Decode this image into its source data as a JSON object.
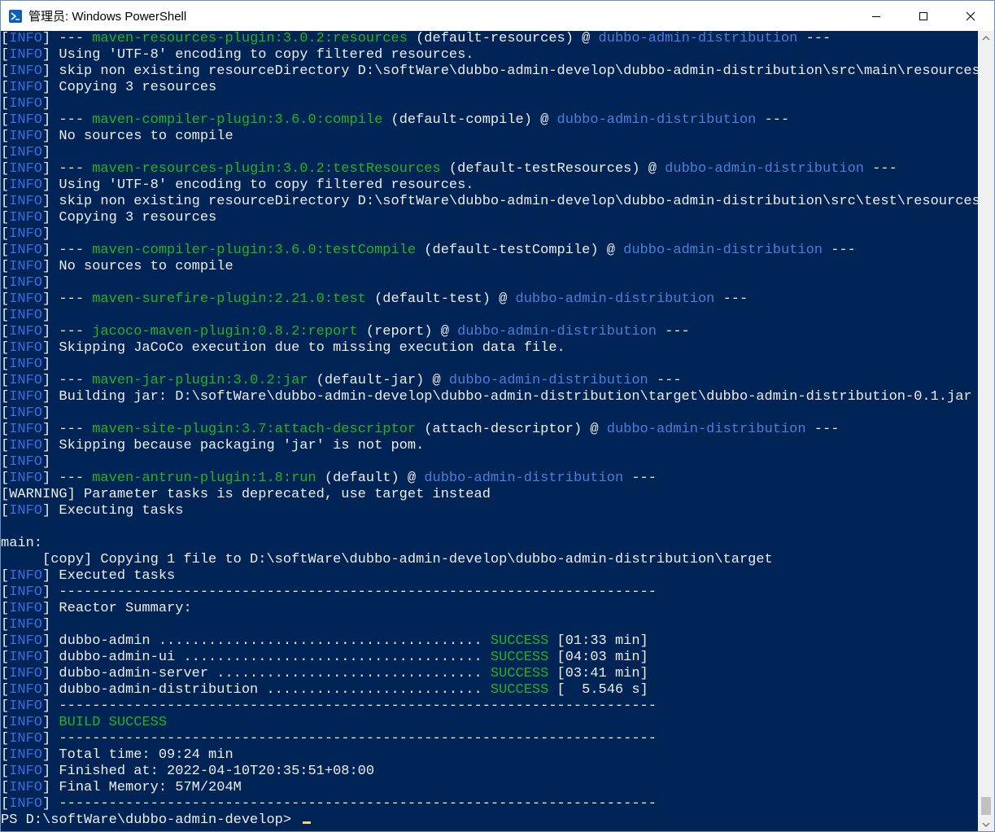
{
  "window": {
    "title": "管理员: Windows PowerShell",
    "controls": [
      "minimize",
      "maximize",
      "close"
    ]
  },
  "colors": {
    "console_bg": "#012456",
    "text": "#eeedf0",
    "info_tag": "#3a6fe0",
    "plugin": "#24b324",
    "module": "#4d7fd8",
    "success": "#24b324"
  },
  "lines": [
    [
      {
        "t": "[",
        "c": "n"
      },
      {
        "t": "INFO",
        "c": "info"
      },
      {
        "t": "] --- ",
        "c": "n"
      },
      {
        "t": "maven-resources-plugin:3.0.2:resources",
        "c": "plugin"
      },
      {
        "t": " (default-resources) @ ",
        "c": "n"
      },
      {
        "t": "dubbo-admin-distribution",
        "c": "module"
      },
      {
        "t": " ---",
        "c": "n"
      }
    ],
    [
      {
        "t": "[",
        "c": "n"
      },
      {
        "t": "INFO",
        "c": "info"
      },
      {
        "t": "] Using 'UTF-8' encoding to copy filtered resources.",
        "c": "n"
      }
    ],
    [
      {
        "t": "[",
        "c": "n"
      },
      {
        "t": "INFO",
        "c": "info"
      },
      {
        "t": "] skip non existing resourceDirectory D:\\softWare\\dubbo-admin-develop\\dubbo-admin-distribution\\src\\main\\resources",
        "c": "n"
      }
    ],
    [
      {
        "t": "[",
        "c": "n"
      },
      {
        "t": "INFO",
        "c": "info"
      },
      {
        "t": "] Copying 3 resources",
        "c": "n"
      }
    ],
    [
      {
        "t": "[",
        "c": "n"
      },
      {
        "t": "INFO",
        "c": "info"
      },
      {
        "t": "]",
        "c": "n"
      }
    ],
    [
      {
        "t": "[",
        "c": "n"
      },
      {
        "t": "INFO",
        "c": "info"
      },
      {
        "t": "] --- ",
        "c": "n"
      },
      {
        "t": "maven-compiler-plugin:3.6.0:compile",
        "c": "plugin"
      },
      {
        "t": " (default-compile) @ ",
        "c": "n"
      },
      {
        "t": "dubbo-admin-distribution",
        "c": "module"
      },
      {
        "t": " ---",
        "c": "n"
      }
    ],
    [
      {
        "t": "[",
        "c": "n"
      },
      {
        "t": "INFO",
        "c": "info"
      },
      {
        "t": "] No sources to compile",
        "c": "n"
      }
    ],
    [
      {
        "t": "[",
        "c": "n"
      },
      {
        "t": "INFO",
        "c": "info"
      },
      {
        "t": "]",
        "c": "n"
      }
    ],
    [
      {
        "t": "[",
        "c": "n"
      },
      {
        "t": "INFO",
        "c": "info"
      },
      {
        "t": "] --- ",
        "c": "n"
      },
      {
        "t": "maven-resources-plugin:3.0.2:testResources",
        "c": "plugin"
      },
      {
        "t": " (default-testResources) @ ",
        "c": "n"
      },
      {
        "t": "dubbo-admin-distribution",
        "c": "module"
      },
      {
        "t": " ---",
        "c": "n"
      }
    ],
    [
      {
        "t": "[",
        "c": "n"
      },
      {
        "t": "INFO",
        "c": "info"
      },
      {
        "t": "] Using 'UTF-8' encoding to copy filtered resources.",
        "c": "n"
      }
    ],
    [
      {
        "t": "[",
        "c": "n"
      },
      {
        "t": "INFO",
        "c": "info"
      },
      {
        "t": "] skip non existing resourceDirectory D:\\softWare\\dubbo-admin-develop\\dubbo-admin-distribution\\src\\test\\resources",
        "c": "n"
      }
    ],
    [
      {
        "t": "[",
        "c": "n"
      },
      {
        "t": "INFO",
        "c": "info"
      },
      {
        "t": "] Copying 3 resources",
        "c": "n"
      }
    ],
    [
      {
        "t": "[",
        "c": "n"
      },
      {
        "t": "INFO",
        "c": "info"
      },
      {
        "t": "]",
        "c": "n"
      }
    ],
    [
      {
        "t": "[",
        "c": "n"
      },
      {
        "t": "INFO",
        "c": "info"
      },
      {
        "t": "] --- ",
        "c": "n"
      },
      {
        "t": "maven-compiler-plugin:3.6.0:testCompile",
        "c": "plugin"
      },
      {
        "t": " (default-testCompile) @ ",
        "c": "n"
      },
      {
        "t": "dubbo-admin-distribution",
        "c": "module"
      },
      {
        "t": " ---",
        "c": "n"
      }
    ],
    [
      {
        "t": "[",
        "c": "n"
      },
      {
        "t": "INFO",
        "c": "info"
      },
      {
        "t": "] No sources to compile",
        "c": "n"
      }
    ],
    [
      {
        "t": "[",
        "c": "n"
      },
      {
        "t": "INFO",
        "c": "info"
      },
      {
        "t": "]",
        "c": "n"
      }
    ],
    [
      {
        "t": "[",
        "c": "n"
      },
      {
        "t": "INFO",
        "c": "info"
      },
      {
        "t": "] --- ",
        "c": "n"
      },
      {
        "t": "maven-surefire-plugin:2.21.0:test",
        "c": "plugin"
      },
      {
        "t": " (default-test) @ ",
        "c": "n"
      },
      {
        "t": "dubbo-admin-distribution",
        "c": "module"
      },
      {
        "t": " ---",
        "c": "n"
      }
    ],
    [
      {
        "t": "[",
        "c": "n"
      },
      {
        "t": "INFO",
        "c": "info"
      },
      {
        "t": "]",
        "c": "n"
      }
    ],
    [
      {
        "t": "[",
        "c": "n"
      },
      {
        "t": "INFO",
        "c": "info"
      },
      {
        "t": "] --- ",
        "c": "n"
      },
      {
        "t": "jacoco-maven-plugin:0.8.2:report",
        "c": "plugin"
      },
      {
        "t": " (report) @ ",
        "c": "n"
      },
      {
        "t": "dubbo-admin-distribution",
        "c": "module"
      },
      {
        "t": " ---",
        "c": "n"
      }
    ],
    [
      {
        "t": "[",
        "c": "n"
      },
      {
        "t": "INFO",
        "c": "info"
      },
      {
        "t": "] Skipping JaCoCo execution due to missing execution data file.",
        "c": "n"
      }
    ],
    [
      {
        "t": "[",
        "c": "n"
      },
      {
        "t": "INFO",
        "c": "info"
      },
      {
        "t": "]",
        "c": "n"
      }
    ],
    [
      {
        "t": "[",
        "c": "n"
      },
      {
        "t": "INFO",
        "c": "info"
      },
      {
        "t": "] --- ",
        "c": "n"
      },
      {
        "t": "maven-jar-plugin:3.0.2:jar",
        "c": "plugin"
      },
      {
        "t": " (default-jar) @ ",
        "c": "n"
      },
      {
        "t": "dubbo-admin-distribution",
        "c": "module"
      },
      {
        "t": " ---",
        "c": "n"
      }
    ],
    [
      {
        "t": "[",
        "c": "n"
      },
      {
        "t": "INFO",
        "c": "info"
      },
      {
        "t": "] Building jar: D:\\softWare\\dubbo-admin-develop\\dubbo-admin-distribution\\target\\dubbo-admin-distribution-0.1.jar",
        "c": "n"
      }
    ],
    [
      {
        "t": "[",
        "c": "n"
      },
      {
        "t": "INFO",
        "c": "info"
      },
      {
        "t": "]",
        "c": "n"
      }
    ],
    [
      {
        "t": "[",
        "c": "n"
      },
      {
        "t": "INFO",
        "c": "info"
      },
      {
        "t": "] --- ",
        "c": "n"
      },
      {
        "t": "maven-site-plugin:3.7:attach-descriptor",
        "c": "plugin"
      },
      {
        "t": " (attach-descriptor) @ ",
        "c": "n"
      },
      {
        "t": "dubbo-admin-distribution",
        "c": "module"
      },
      {
        "t": " ---",
        "c": "n"
      }
    ],
    [
      {
        "t": "[",
        "c": "n"
      },
      {
        "t": "INFO",
        "c": "info"
      },
      {
        "t": "] Skipping because packaging 'jar' is not pom.",
        "c": "n"
      }
    ],
    [
      {
        "t": "[",
        "c": "n"
      },
      {
        "t": "INFO",
        "c": "info"
      },
      {
        "t": "]",
        "c": "n"
      }
    ],
    [
      {
        "t": "[",
        "c": "n"
      },
      {
        "t": "INFO",
        "c": "info"
      },
      {
        "t": "] --- ",
        "c": "n"
      },
      {
        "t": "maven-antrun-plugin:1.8:run",
        "c": "plugin"
      },
      {
        "t": " (default) @ ",
        "c": "n"
      },
      {
        "t": "dubbo-admin-distribution",
        "c": "module"
      },
      {
        "t": " ---",
        "c": "n"
      }
    ],
    [
      {
        "t": "[WARNING] Parameter tasks is deprecated, use target instead",
        "c": "n"
      }
    ],
    [
      {
        "t": "[",
        "c": "n"
      },
      {
        "t": "INFO",
        "c": "info"
      },
      {
        "t": "] Executing tasks",
        "c": "n"
      }
    ],
    [],
    [
      {
        "t": "main:",
        "c": "n"
      }
    ],
    [
      {
        "t": "     [copy] Copying 1 file to D:\\softWare\\dubbo-admin-develop\\dubbo-admin-distribution\\target",
        "c": "n"
      }
    ],
    [
      {
        "t": "[",
        "c": "n"
      },
      {
        "t": "INFO",
        "c": "info"
      },
      {
        "t": "] Executed tasks",
        "c": "n"
      }
    ],
    [
      {
        "t": "[",
        "c": "n"
      },
      {
        "t": "INFO",
        "c": "info"
      },
      {
        "t": "] ------------------------------------------------------------------------",
        "c": "n"
      }
    ],
    [
      {
        "t": "[",
        "c": "n"
      },
      {
        "t": "INFO",
        "c": "info"
      },
      {
        "t": "] Reactor Summary:",
        "c": "n"
      }
    ],
    [
      {
        "t": "[",
        "c": "n"
      },
      {
        "t": "INFO",
        "c": "info"
      },
      {
        "t": "]",
        "c": "n"
      }
    ],
    [
      {
        "t": "[",
        "c": "n"
      },
      {
        "t": "INFO",
        "c": "info"
      },
      {
        "t": "] dubbo-admin ....................................... ",
        "c": "n"
      },
      {
        "t": "SUCCESS",
        "c": "succ"
      },
      {
        "t": " [01:33 min]",
        "c": "n"
      }
    ],
    [
      {
        "t": "[",
        "c": "n"
      },
      {
        "t": "INFO",
        "c": "info"
      },
      {
        "t": "] dubbo-admin-ui .................................... ",
        "c": "n"
      },
      {
        "t": "SUCCESS",
        "c": "succ"
      },
      {
        "t": " [04:03 min]",
        "c": "n"
      }
    ],
    [
      {
        "t": "[",
        "c": "n"
      },
      {
        "t": "INFO",
        "c": "info"
      },
      {
        "t": "] dubbo-admin-server ................................ ",
        "c": "n"
      },
      {
        "t": "SUCCESS",
        "c": "succ"
      },
      {
        "t": " [03:41 min]",
        "c": "n"
      }
    ],
    [
      {
        "t": "[",
        "c": "n"
      },
      {
        "t": "INFO",
        "c": "info"
      },
      {
        "t": "] dubbo-admin-distribution .......................... ",
        "c": "n"
      },
      {
        "t": "SUCCESS",
        "c": "succ"
      },
      {
        "t": " [  5.546 s]",
        "c": "n"
      }
    ],
    [
      {
        "t": "[",
        "c": "n"
      },
      {
        "t": "INFO",
        "c": "info"
      },
      {
        "t": "] ------------------------------------------------------------------------",
        "c": "n"
      }
    ],
    [
      {
        "t": "[",
        "c": "n"
      },
      {
        "t": "INFO",
        "c": "info"
      },
      {
        "t": "] ",
        "c": "n"
      },
      {
        "t": "BUILD SUCCESS",
        "c": "build"
      }
    ],
    [
      {
        "t": "[",
        "c": "n"
      },
      {
        "t": "INFO",
        "c": "info"
      },
      {
        "t": "] ------------------------------------------------------------------------",
        "c": "n"
      }
    ],
    [
      {
        "t": "[",
        "c": "n"
      },
      {
        "t": "INFO",
        "c": "info"
      },
      {
        "t": "] Total time: 09:24 min",
        "c": "n"
      }
    ],
    [
      {
        "t": "[",
        "c": "n"
      },
      {
        "t": "INFO",
        "c": "info"
      },
      {
        "t": "] Finished at: 2022-04-10T20:35:51+08:00",
        "c": "n"
      }
    ],
    [
      {
        "t": "[",
        "c": "n"
      },
      {
        "t": "INFO",
        "c": "info"
      },
      {
        "t": "] Final Memory: 57M/204M",
        "c": "n"
      }
    ],
    [
      {
        "t": "[",
        "c": "n"
      },
      {
        "t": "INFO",
        "c": "info"
      },
      {
        "t": "] ------------------------------------------------------------------------",
        "c": "n"
      }
    ]
  ],
  "prompt": {
    "text": "PS D:\\softWare\\dubbo-admin-develop> "
  }
}
